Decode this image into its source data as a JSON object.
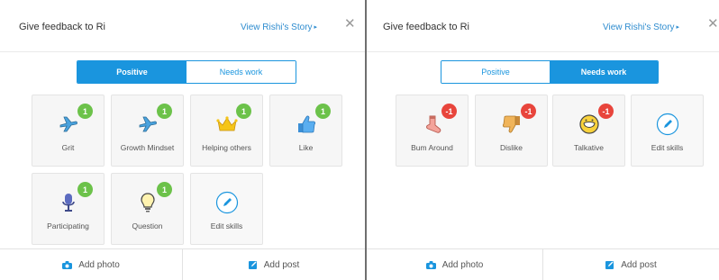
{
  "colors": {
    "accent": "#1a95de",
    "positive_badge": "#6cc24a",
    "negative_badge": "#e8453c"
  },
  "left_panel": {
    "title": "Give feedback to Ri",
    "story_link": "View Rishi's Story",
    "story_arrow": "▸",
    "close": "✕",
    "toggle": {
      "positive": "Positive",
      "needs_work": "Needs work",
      "selected": "Positive"
    },
    "skills": [
      {
        "label": "Grit",
        "badge": "1",
        "icon": "airplane-icon"
      },
      {
        "label": "Growth Mindset",
        "badge": "1",
        "icon": "airplane-icon"
      },
      {
        "label": "Helping others",
        "badge": "1",
        "icon": "crown-icon"
      },
      {
        "label": "Like",
        "badge": "1",
        "icon": "thumbs-up-icon"
      },
      {
        "label": "Participating",
        "badge": "1",
        "icon": "microphone-icon"
      },
      {
        "label": "Question",
        "badge": "1",
        "icon": "lightbulb-icon"
      },
      {
        "label": "Edit skills",
        "icon": "pencil-icon"
      }
    ],
    "footer": {
      "add_photo": "Add photo",
      "add_post": "Add post"
    }
  },
  "right_panel": {
    "title": "Give feedback to Ri",
    "story_link": "View Rishi's Story",
    "story_arrow": "▸",
    "close": "✕",
    "toggle": {
      "positive": "Positive",
      "needs_work": "Needs work",
      "selected": "Needs work"
    },
    "skills": [
      {
        "label": "Bum Around",
        "badge": "-1",
        "icon": "sock-icon"
      },
      {
        "label": "Dislike",
        "badge": "-1",
        "icon": "thumbs-down-icon"
      },
      {
        "label": "Talkative",
        "badge": "-1",
        "icon": "talking-face-icon"
      },
      {
        "label": "Edit skills",
        "icon": "pencil-icon"
      }
    ],
    "footer": {
      "add_photo": "Add photo",
      "add_post": "Add post"
    }
  }
}
